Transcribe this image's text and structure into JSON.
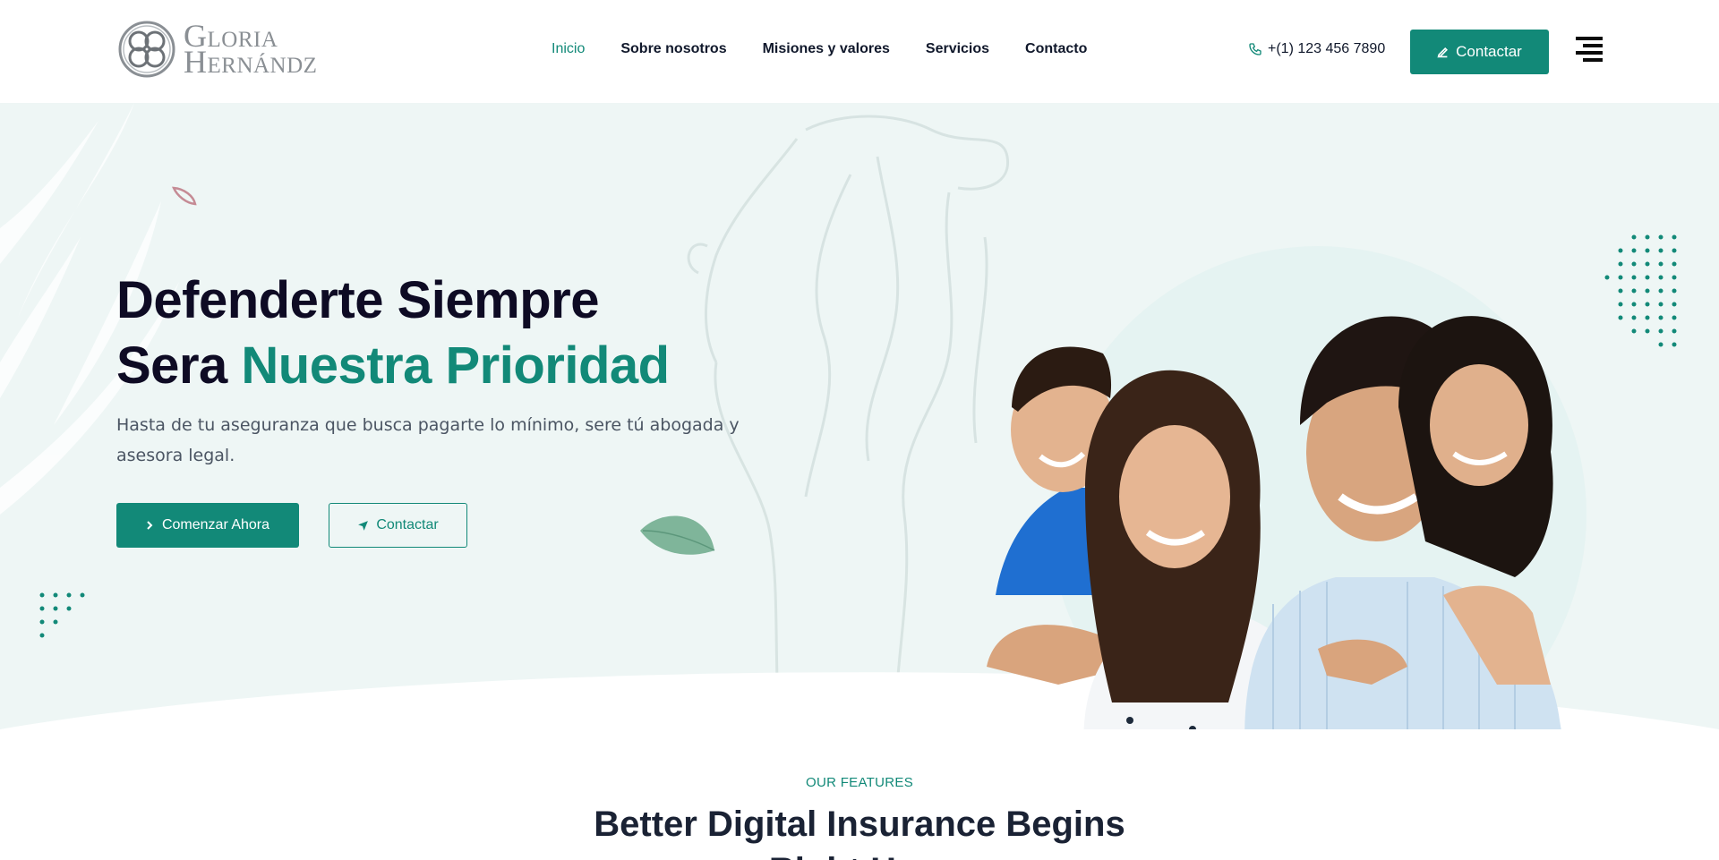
{
  "brand": {
    "logo_text_line1": "Gloria",
    "logo_text_line2": "Hernándz"
  },
  "nav": {
    "items": [
      {
        "label": "Inicio",
        "active": true
      },
      {
        "label": "Sobre nosotros",
        "active": false
      },
      {
        "label": "Misiones y valores",
        "active": false
      },
      {
        "label": "Servicios",
        "active": false
      },
      {
        "label": "Contacto",
        "active": false
      }
    ]
  },
  "header": {
    "phone": "+(1) 123 456 7890",
    "cta_label": "Contactar"
  },
  "hero": {
    "title_line1": "Defenderte Siempre",
    "title_line2_part1": "Sera ",
    "title_line2_highlight": "Nuestra Prioridad",
    "description": "Hasta de tu aseguranza que busca pagarte lo mínimo, sere tú abogada y asesora legal.",
    "primary_button": "Comenzar Ahora",
    "secondary_button": "Contactar"
  },
  "features": {
    "label": "OUR FEATURES",
    "title_line1": "Better Digital Insurance Begins",
    "title_line2": "Right Here"
  },
  "colors": {
    "accent": "#128978",
    "hero_bg": "#eef6f5",
    "dark": "#0e0b24"
  },
  "icons": [
    "logo-mark-icon",
    "phone-icon",
    "pencil-icon",
    "chevron-right-icon",
    "send-icon",
    "menu-icon",
    "leaf-icon",
    "dots-pattern-icon"
  ]
}
